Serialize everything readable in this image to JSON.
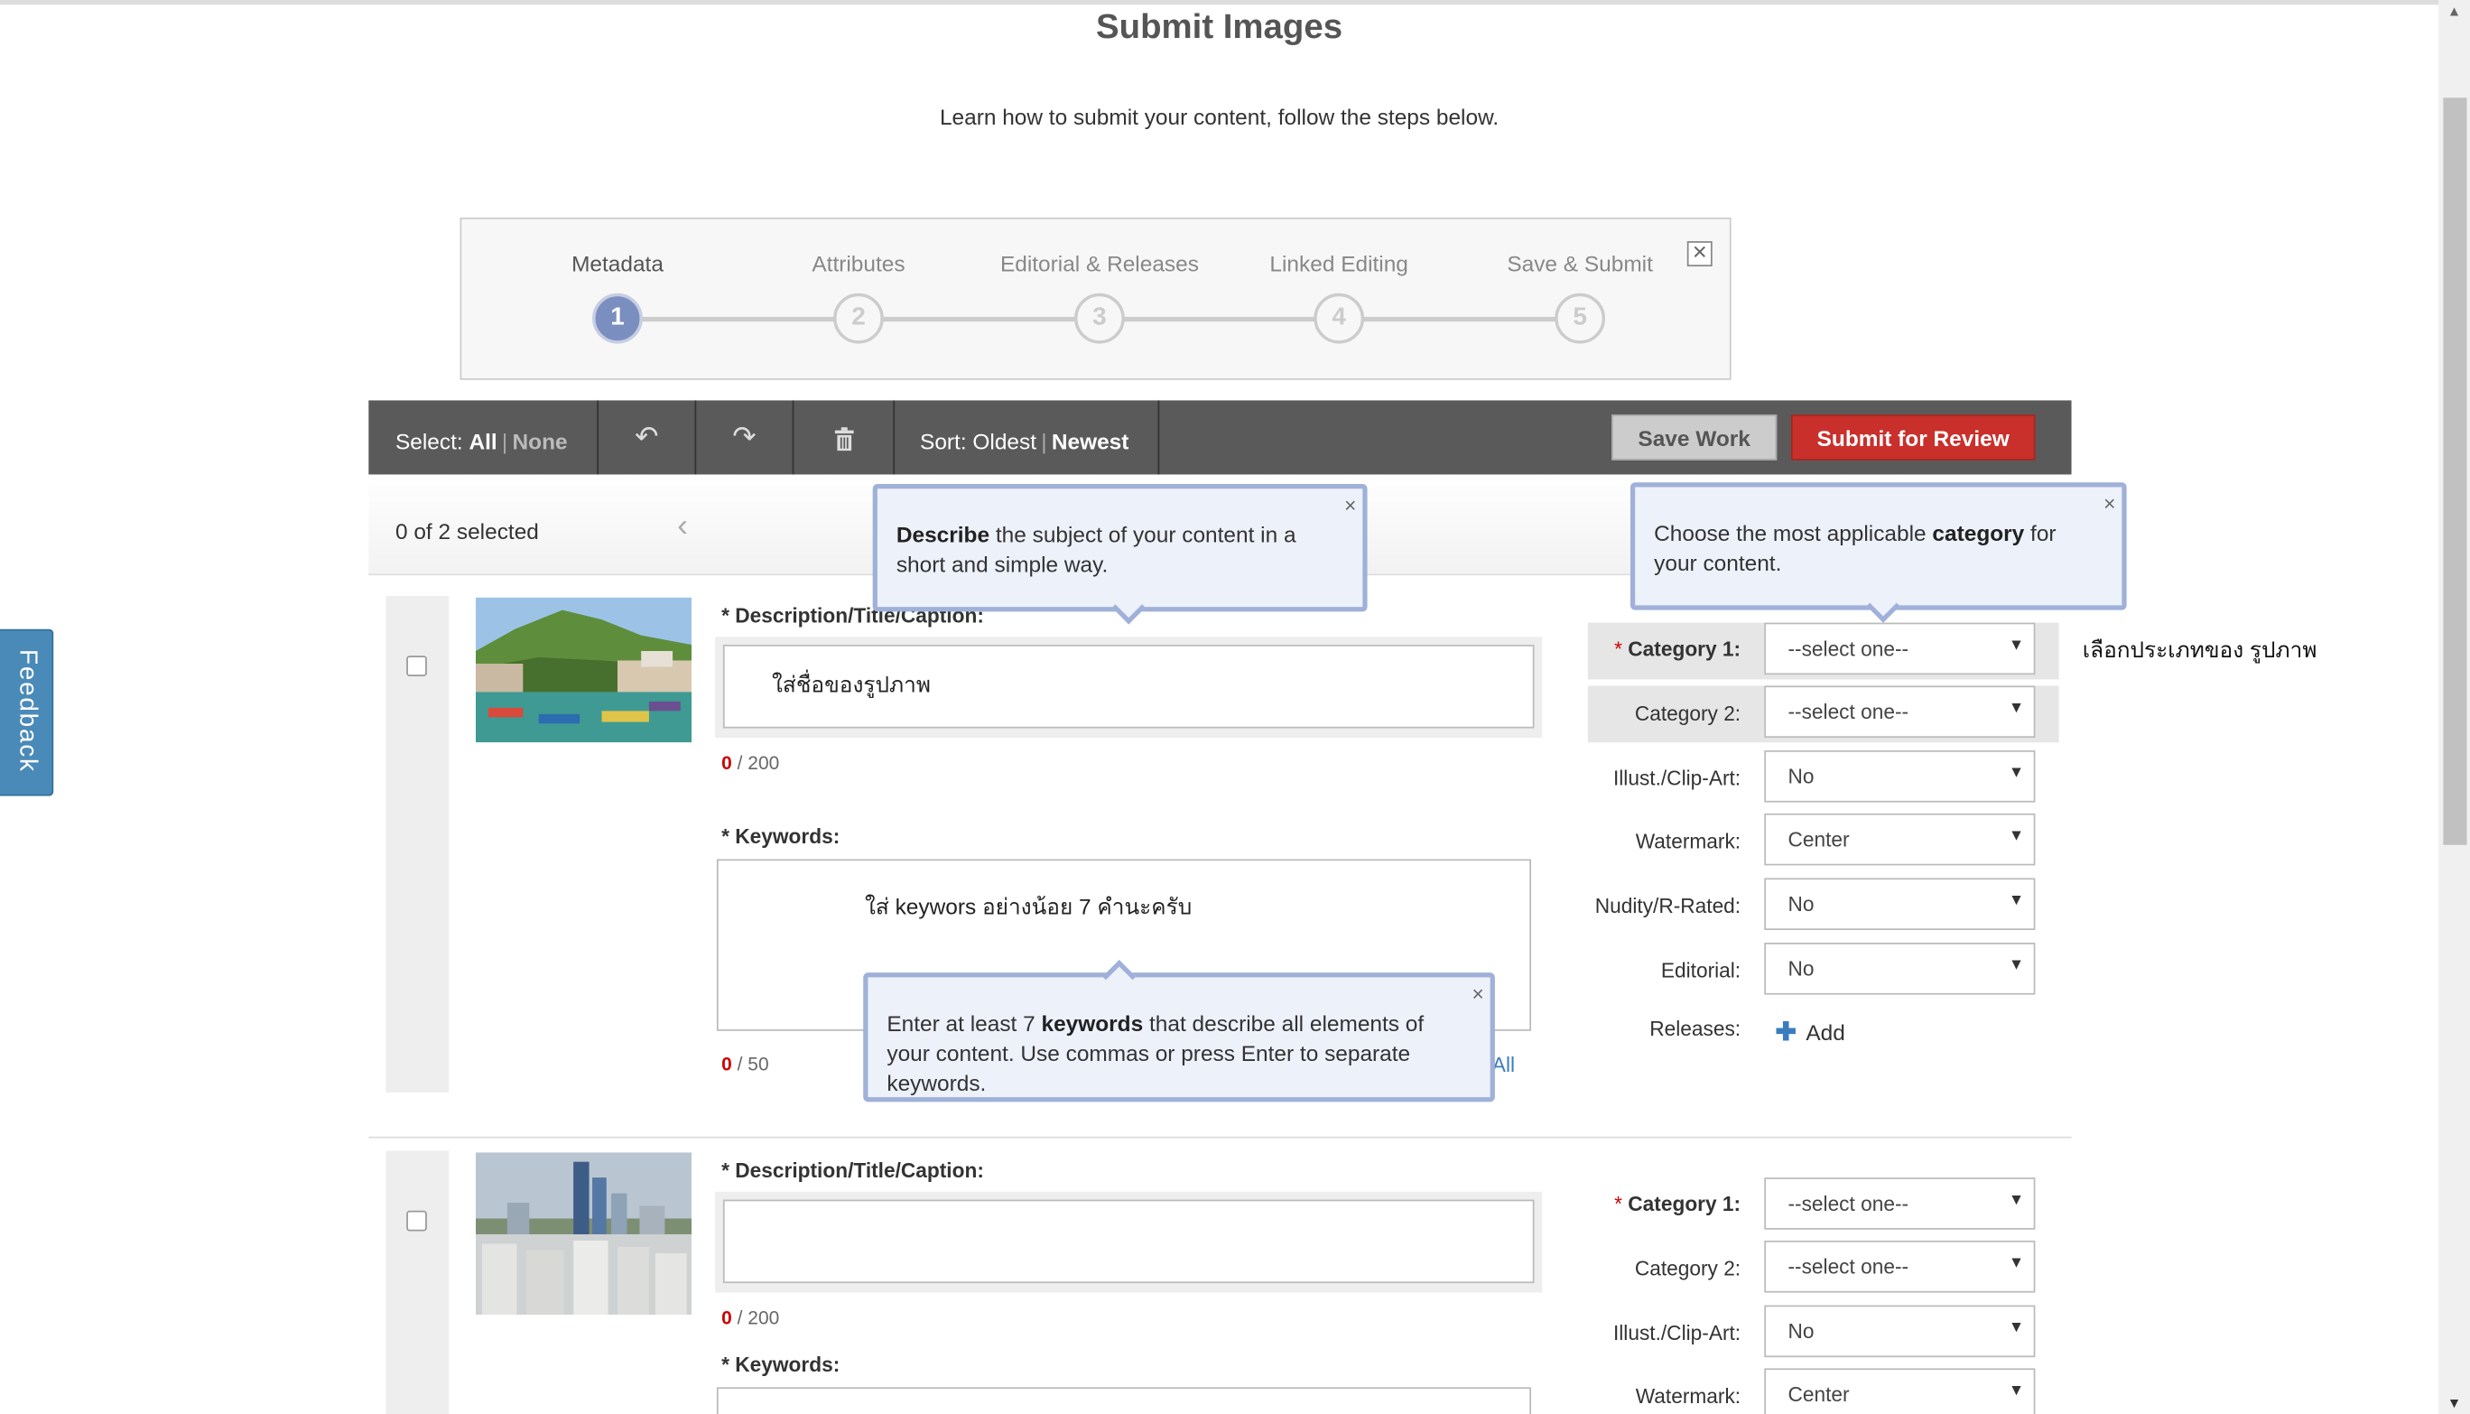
{
  "page": {
    "title": "Submit Images",
    "intro": "Learn how to submit your content, follow the steps below."
  },
  "stepper": {
    "steps": [
      {
        "label": "Metadata",
        "number": "1"
      },
      {
        "label": "Attributes",
        "number": "2"
      },
      {
        "label": "Editorial & Releases",
        "number": "3"
      },
      {
        "label": "Linked Editing",
        "number": "4"
      },
      {
        "label": "Save & Submit",
        "number": "5"
      }
    ],
    "active_step": 1,
    "close_icon": "close-icon"
  },
  "toolbar": {
    "select_label": "Select:",
    "select_all": "All",
    "select_none": "None",
    "undo_icon": "undo-icon",
    "redo_icon": "redo-icon",
    "trash_icon": "trash-icon",
    "sort_label": "Sort:",
    "sort_oldest": "Oldest",
    "sort_newest": "Newest",
    "save_work": "Save Work",
    "submit_review": "Submit for Review"
  },
  "selection": {
    "count_text": "0 of 2 selected"
  },
  "tooltips": {
    "description": {
      "bold": "Describe",
      "rest": " the subject of your content in a short and simple way."
    },
    "category": {
      "pre": "Choose the most applicable ",
      "bold": "category",
      "post": " for your content."
    },
    "keywords": {
      "pre": "Enter at least 7 ",
      "bold": "keywords",
      "post": " that describe all elements of your content. Use commas or press Enter to separate keywords."
    },
    "close_glyph": "×"
  },
  "items": [
    {
      "description_label": "* Description/Title/Caption:",
      "description_value": "ใส่ชื่อของรูปภาพ",
      "description_count": "0",
      "description_max": "/ 200",
      "keywords_label": "* Keywords:",
      "keywords_value": "ใส่ keywors อย่างน้อย 7 คำนะครับ",
      "keywords_count": "0",
      "keywords_max": "/ 50",
      "clear_all": "r All",
      "fields": {
        "category1_label": "Category 1:",
        "category1_value": "--select one--",
        "category2_label": "Category 2:",
        "category2_value": "--select one--",
        "illust_label": "Illust./Clip-Art:",
        "illust_value": "No",
        "watermark_label": "Watermark:",
        "watermark_value": "Center",
        "nudity_label": "Nudity/R-Rated:",
        "nudity_value": "No",
        "editorial_label": "Editorial:",
        "editorial_value": "No",
        "releases_label": "Releases:",
        "releases_add": "Add"
      },
      "annotation": "เลือกประเภทของ รูปภาพ"
    },
    {
      "description_label": "* Description/Title/Caption:",
      "description_value": "",
      "description_count": "0",
      "description_max": "/ 200",
      "keywords_label": "* Keywords:",
      "fields": {
        "category1_label": "Category 1:",
        "category1_value": "--select one--",
        "category2_label": "Category 2:",
        "category2_value": "--select one--",
        "illust_label": "Illust./Clip-Art:",
        "illust_value": "No",
        "watermark_label": "Watermark:",
        "watermark_value": "Center"
      }
    }
  ],
  "feedback": {
    "label": "Feedback"
  },
  "colors": {
    "toolbar": "#5a5a5a",
    "submit": "#c9302c",
    "step_active": "#7a8ec0",
    "tooltip_border": "#9fb1d9",
    "feedback": "#4a8ab8"
  }
}
